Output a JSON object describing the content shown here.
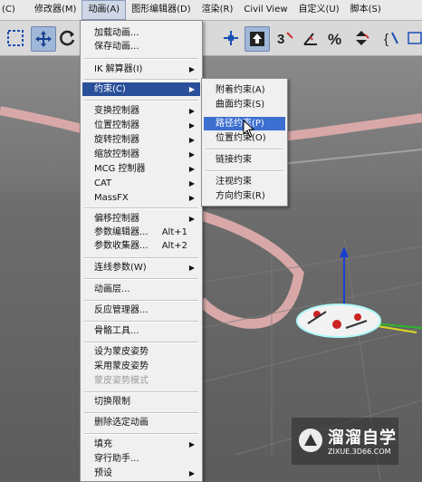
{
  "menubar": {
    "items": [
      "(C)",
      "修改器(M)",
      "动画(A)",
      "图形编辑器(D)",
      "渲染(R)",
      "Civil View",
      "自定义(U)",
      "脚本(S)"
    ]
  },
  "animation_menu": {
    "items": [
      {
        "label": "加载动画..."
      },
      {
        "label": "保存动画..."
      },
      {
        "label": "IK 解算器(I)",
        "submenu": true
      },
      {
        "label": "约束(C)",
        "submenu": true,
        "highlighted": true
      },
      {
        "label": "变换控制器",
        "submenu": true
      },
      {
        "label": "位置控制器",
        "submenu": true
      },
      {
        "label": "旋转控制器",
        "submenu": true
      },
      {
        "label": "缩放控制器",
        "submenu": true
      },
      {
        "label": "MCG 控制器",
        "submenu": true
      },
      {
        "label": "CAT",
        "submenu": true
      },
      {
        "label": "MassFX",
        "submenu": true
      },
      {
        "label": "偏移控制器",
        "submenu": true
      },
      {
        "label": "参数编辑器...",
        "shortcut": "Alt+1"
      },
      {
        "label": "参数收集器...",
        "shortcut": "Alt+2"
      },
      {
        "label": "连线参数(W)",
        "submenu": true
      },
      {
        "label": "动画层..."
      },
      {
        "label": "反应管理器..."
      },
      {
        "label": "骨骼工具..."
      },
      {
        "label": "设为蒙皮姿势"
      },
      {
        "label": "采用蒙皮姿势"
      },
      {
        "label": "蒙皮姿势模式",
        "disabled": true
      },
      {
        "label": "切换限制"
      },
      {
        "label": "删除选定动画"
      },
      {
        "label": "填充",
        "submenu": true
      },
      {
        "label": "穿行助手..."
      },
      {
        "label": "预设",
        "submenu": true
      }
    ]
  },
  "constraint_submenu": {
    "items": [
      {
        "label": "附着约束(A)"
      },
      {
        "label": "曲面约束(S)"
      },
      {
        "label": "路径约束(P)",
        "highlighted": true
      },
      {
        "label": "位置约束(O)"
      },
      {
        "label": "链接约束"
      },
      {
        "label": "注视约束"
      },
      {
        "label": "方向约束(R)"
      }
    ]
  },
  "watermark": {
    "title": "溜溜自学",
    "url": "ZIXUE.3D66.COM"
  },
  "colors": {
    "menu_highlight": "#2a4f9a",
    "submenu_highlight": "#3d6fd0",
    "path_band": "#d8a8a8"
  }
}
